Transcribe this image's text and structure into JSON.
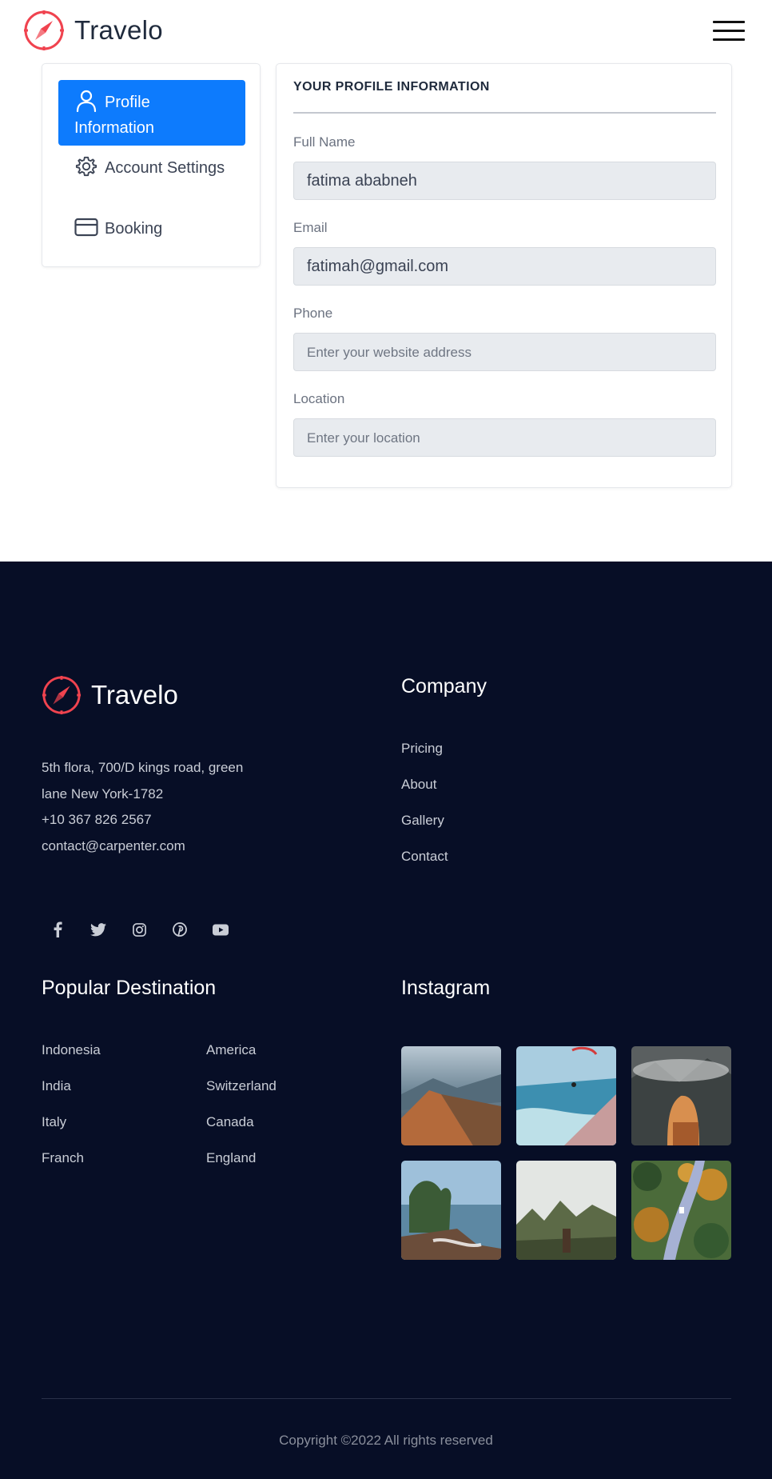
{
  "header": {
    "brand_name": "Travelo",
    "logo_icon": "compass-icon",
    "menu_icon": "hamburger-menu-icon"
  },
  "sidebar": {
    "items": [
      {
        "label": "Profile Information",
        "icon": "user-icon",
        "active": true
      },
      {
        "label": "Account Settings",
        "icon": "gear-icon",
        "active": false
      },
      {
        "label": "Booking",
        "icon": "credit-card-icon",
        "active": false
      }
    ]
  },
  "profile": {
    "title": "YOUR PROFILE INFORMATION",
    "fields": [
      {
        "label": "Full Name",
        "value": "fatima ababneh",
        "placeholder": ""
      },
      {
        "label": "Email",
        "value": "fatimah@gmail.com",
        "placeholder": ""
      },
      {
        "label": "Phone",
        "value": "",
        "placeholder": "Enter your website address"
      },
      {
        "label": "Location",
        "value": "",
        "placeholder": "Enter your location"
      }
    ]
  },
  "footer": {
    "brand_name": "Travelo",
    "address_line1": "5th flora, 700/D kings road, green",
    "address_line2": "lane New York-1782",
    "phone": "+10 367 826 2567",
    "email": "contact@carpenter.com",
    "social": [
      "facebook-icon",
      "twitter-icon",
      "instagram-icon",
      "pinterest-icon",
      "youtube-icon"
    ],
    "company": {
      "heading": "Company",
      "links": [
        "Pricing",
        "About",
        "Gallery",
        "Contact"
      ]
    },
    "popular": {
      "heading": "Popular Destination",
      "col1": [
        "Indonesia",
        "India",
        "Italy",
        "Franch"
      ],
      "col2": [
        "America",
        "Switzerland",
        "Canada",
        "England"
      ]
    },
    "instagram": {
      "heading": "Instagram",
      "photos": [
        "mountain-lake-photo",
        "paraglider-coast-photo",
        "hiker-mountains-photo",
        "temple-sea-photo",
        "forest-hiker-photo",
        "forest-road-photo"
      ]
    },
    "copyright": "Copyright ©2022 All rights reserved"
  },
  "colors": {
    "accent": "#0d7bfd",
    "brand_red": "#f0434f",
    "footer_bg": "#070e26"
  }
}
